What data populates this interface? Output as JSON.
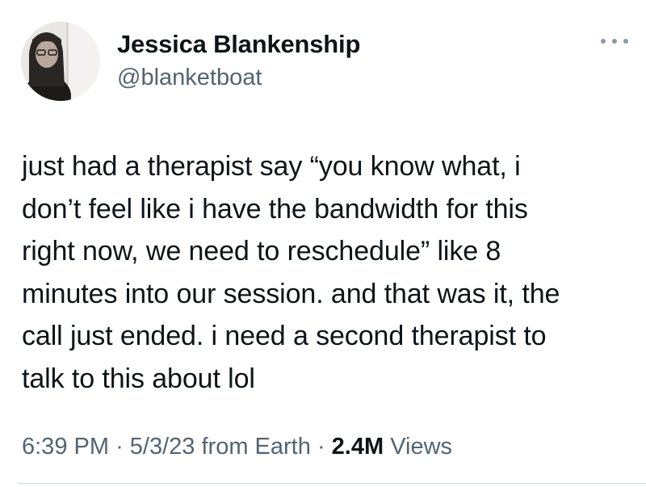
{
  "author": {
    "display_name": "Jessica Blankenship",
    "handle": "@blanketboat"
  },
  "tweet": {
    "lines": [
      "just had a therapist say “you know what, i",
      "don’t feel like i have the bandwidth for this",
      "right now, we need to reschedule” like 8",
      "minutes into our session. and that was it, the",
      "call just ended. i need a second therapist to",
      "talk to this about lol"
    ]
  },
  "meta": {
    "time": "6:39 PM",
    "separator": "·",
    "date": "5/3/23",
    "source": "from Earth",
    "views_count": "2.4M",
    "views_label": "Views"
  },
  "icons": {
    "more": "more-horizontal-icon"
  },
  "colors": {
    "text": "#0f1419",
    "secondary": "#536471",
    "divider": "#cfd9de"
  }
}
